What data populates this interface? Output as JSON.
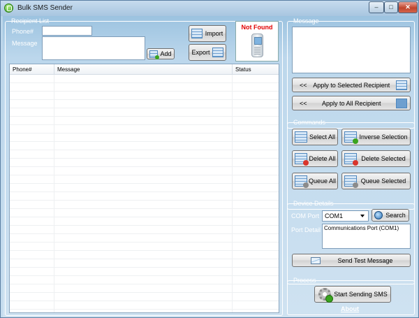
{
  "window": {
    "title": "Bulk SMS Sender",
    "min_glyph": "–",
    "max_glyph": "□",
    "close_glyph": "✕"
  },
  "recipient": {
    "group_label": "Recipient List",
    "phone_label": "Phone#",
    "phone_value": "",
    "message_label": "Message",
    "message_value": "",
    "add_label": "Add",
    "import_label": "Import",
    "export_label": "Export",
    "status_text": "Not Found",
    "columns": [
      "Phone#",
      "Message",
      "Status"
    ]
  },
  "message": {
    "group_label": "Message",
    "text": "",
    "apply_selected_arrows": "<<",
    "apply_selected_label": "Apply to Selected Recipient",
    "apply_all_arrows": "<<",
    "apply_all_label": "Apply to All Recipient"
  },
  "commands": {
    "group_label": "Commands",
    "select_all": "Select All",
    "inverse_selection": "Inverse Selection",
    "delete_all": "Delete All",
    "delete_selected": "Delete Selected",
    "queue_all": "Queue All",
    "queue_selected": "Queue Selected"
  },
  "device": {
    "group_label": "Device Details",
    "com_port_label": "COM Port",
    "com_port_value": "COM1",
    "search_label": "Search",
    "port_detail_label": "Port Detail",
    "port_detail_value": "Communications Port (COM1)",
    "send_test_label": "Send Test Message"
  },
  "process": {
    "group_label": "Process",
    "start_label": "Start Sending SMS",
    "about_label": "About"
  },
  "colors": {
    "accent": "#4d86bd",
    "status_error": "#e00000",
    "badge_green": "#3aa41e",
    "badge_red": "#d9352b"
  }
}
